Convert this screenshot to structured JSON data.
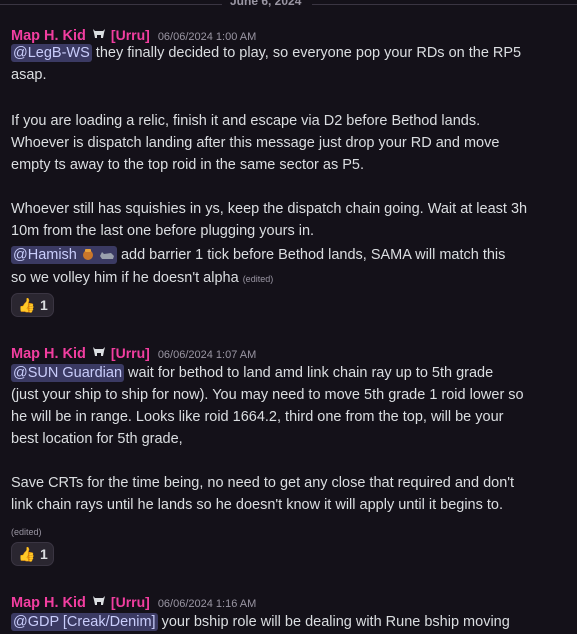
{
  "date_divider": "June 6, 2024",
  "messages": [
    {
      "author": "Map H. Kid",
      "tag": "[Urru]",
      "timestamp": "06/06/2024 1:00 AM",
      "mention1": "@LegB-WS",
      "line1_rest": " they finally decided to play, so everyone pop your RDs on the RP5",
      "line2": "asap.",
      "line3": "If you are loading a relic, finish it and escape via D2 before Bethod lands.",
      "line4": "Whoever is dispatch landing after this message just drop your RD and move",
      "line5": "empty ts away to the top roid in the same sector as P5.",
      "line6": "Whoever still has squishies in ys, keep the dispatch chain going. Wait at least 3h",
      "line7": "10m from the last one before plugging yours in.",
      "mention2": "@Hamish",
      "line8_rest": " add barrier 1 tick before Bethod lands, SAMA will match this",
      "line9": "so we volley him if he doesn't alpha",
      "edited": "(edited)",
      "reaction_count": "1"
    },
    {
      "author": "Map H. Kid",
      "tag": "[Urru]",
      "timestamp": "06/06/2024 1:07 AM",
      "mention1": "@SUN Guardian",
      "line1_rest": " wait for bethod to land amd link chain ray up to 5th grade",
      "line2": "(just your ship to ship for now). You may need to move 5th grade 1 roid lower so",
      "line3": "he will be in range. Looks like roid 1664.2, third one from the top, will be your",
      "line4": "best location for 5th grade,",
      "line5": "Save CRTs for the time being, no need to get any close that required and don't",
      "line6": "link chain rays until he lands so he doesn't know it will apply until it begins to.",
      "edited": "(edited)",
      "reaction_count": "1"
    },
    {
      "author": "Map H. Kid",
      "tag": "[Urru]",
      "timestamp": "06/06/2024 1:16 AM",
      "mention1": "@GDP [Creak/Denim]",
      "line1_rest": " your bship role will be dealing with Rune bship moving"
    }
  ]
}
